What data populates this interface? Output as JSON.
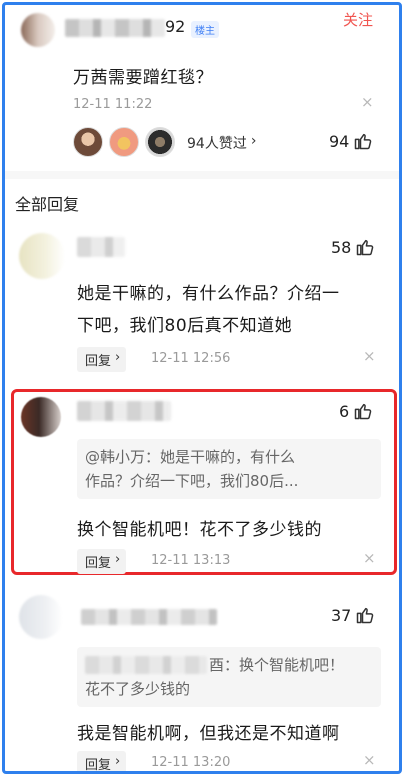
{
  "top_comment": {
    "name_suffix": "92",
    "author_tag": "楼主",
    "follow_label": "关注",
    "text": "万茜需要蹭红毯？",
    "time": "12-11 11:22",
    "likers_label": "94人赞过",
    "likers_chevron": "›",
    "like_count": "94"
  },
  "section_title": "全部回复",
  "replies": [
    {
      "like_count": "58",
      "text_line1": "她是干嘛的，有什么作品？介绍一",
      "text_line2": "下吧，我们80后真不知道她",
      "reply_label": "回复",
      "chevron": "›",
      "time": "12-11 12:56"
    },
    {
      "like_count": "6",
      "quote_line1": "@韩小万：她是干嘛的，有什么",
      "quote_line2": "作品？介绍一下吧，我们80后...",
      "text": "换个智能机吧！花不了多少钱的",
      "reply_label": "回复",
      "chevron": "›",
      "time": "12-11 13:13",
      "highlighted": true
    },
    {
      "like_count": "37",
      "quote_line1_visible": "酉：换个智能机吧！",
      "quote_line2": "花不了多少钱的",
      "text": "我是智能机啊，但我还是不知道啊",
      "reply_label": "回复",
      "chevron": "›",
      "time": "12-11 13:20"
    }
  ],
  "icons": {
    "close": "×",
    "thumbs_up": "thumbs-up-icon"
  },
  "colors": {
    "follow": "#f0544f",
    "highlight_border": "#e8282b",
    "frame_border": "#2f80ed",
    "tag_text": "#3d7ef5"
  }
}
